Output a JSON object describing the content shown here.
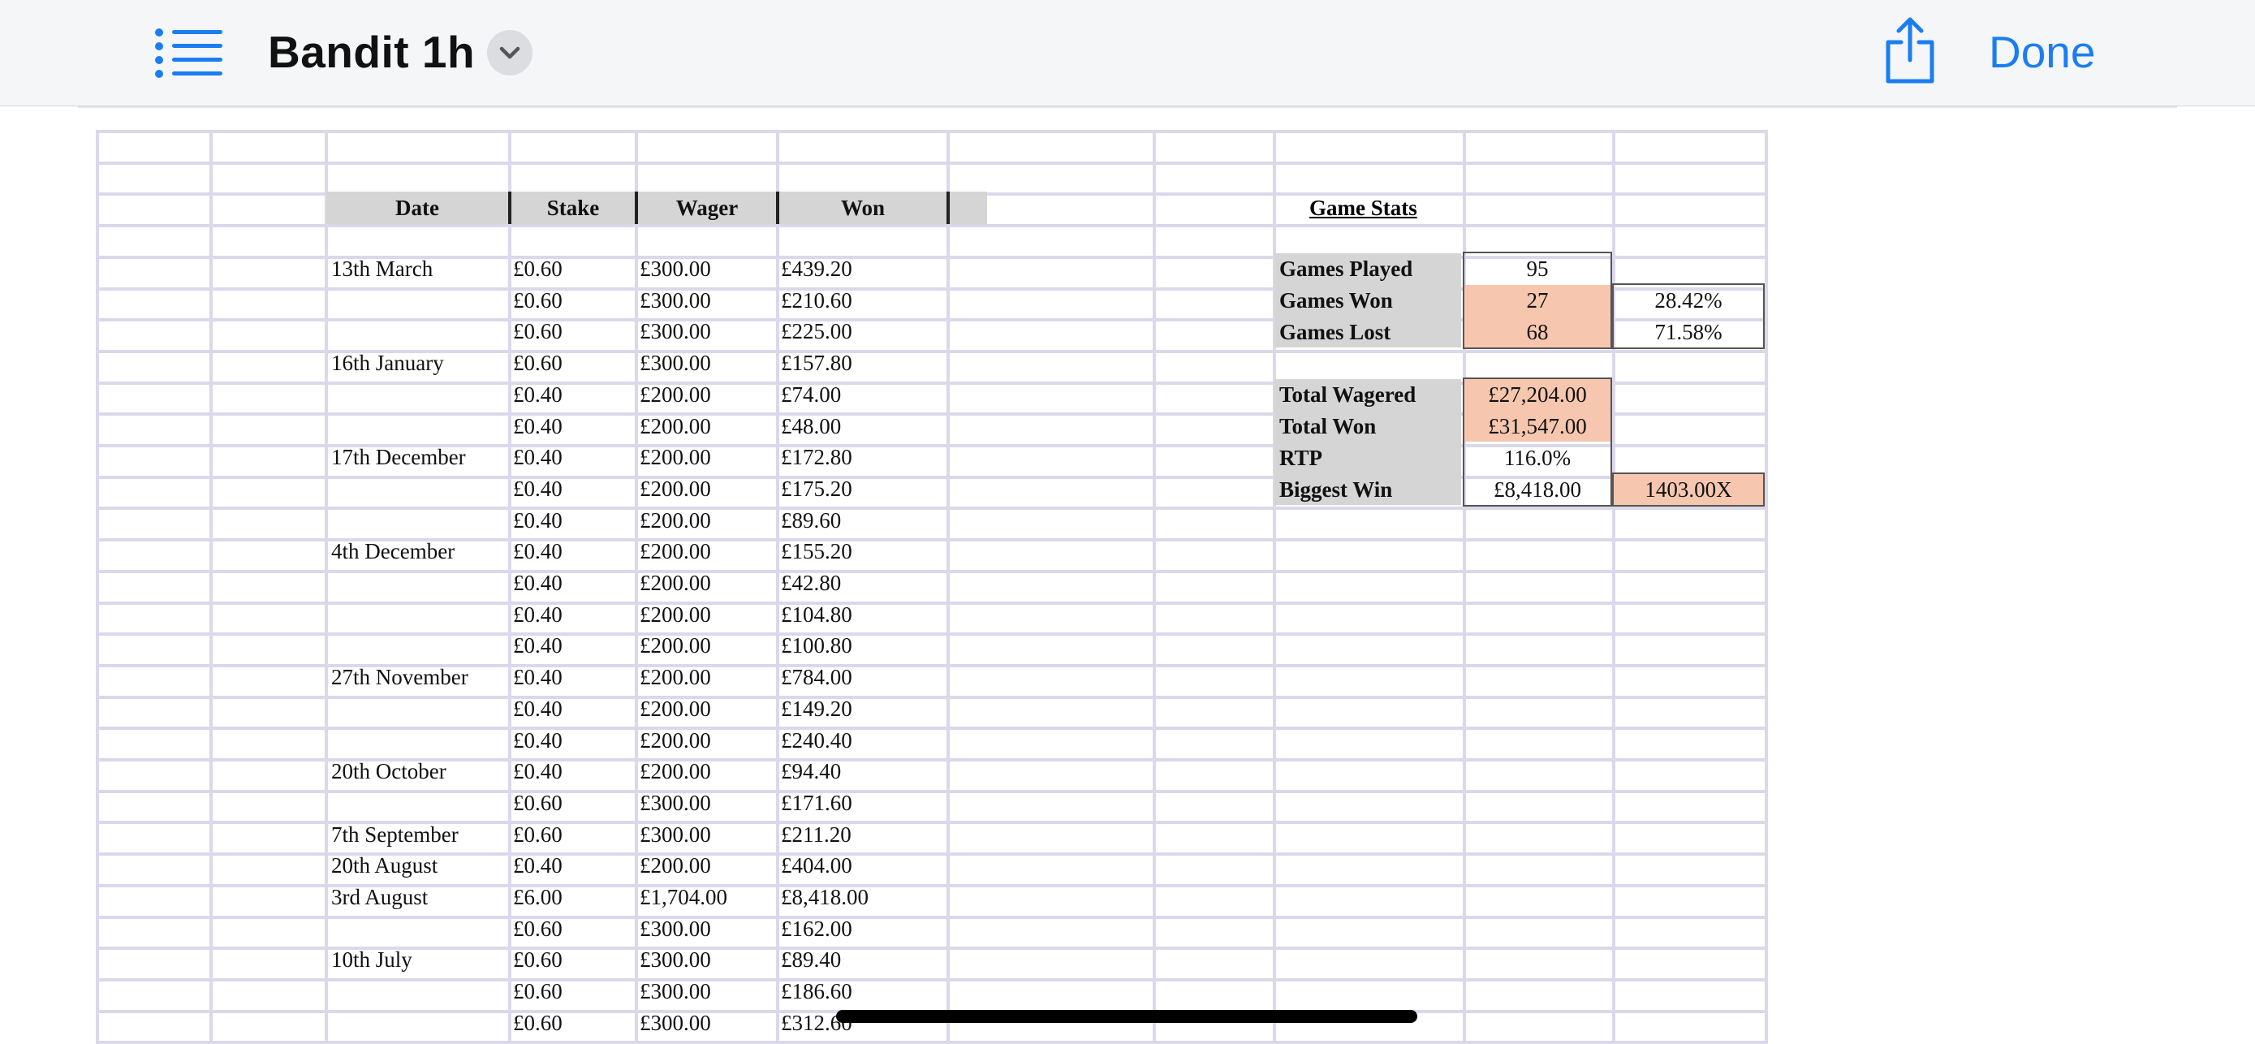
{
  "toolbar": {
    "title": "Bandit 1h",
    "done_label": "Done",
    "list_icon": "list-icon",
    "chevron_icon": "chevron-down-icon",
    "share_icon": "share-icon",
    "accent_color": "#1a7ef2"
  },
  "table": {
    "headers": [
      "Date",
      "Stake",
      "Wager",
      "Won"
    ],
    "rows": [
      [
        "13th March",
        "£0.60",
        "£300.00",
        "£439.20"
      ],
      [
        "",
        "£0.60",
        "£300.00",
        "£210.60"
      ],
      [
        "",
        "£0.60",
        "£300.00",
        "£225.00"
      ],
      [
        "16th January",
        "£0.60",
        "£300.00",
        "£157.80"
      ],
      [
        "",
        "£0.40",
        "£200.00",
        "£74.00"
      ],
      [
        "",
        "£0.40",
        "£200.00",
        "£48.00"
      ],
      [
        "17th December",
        "£0.40",
        "£200.00",
        "£172.80"
      ],
      [
        "",
        "£0.40",
        "£200.00",
        "£175.20"
      ],
      [
        "",
        "£0.40",
        "£200.00",
        "£89.60"
      ],
      [
        "4th December",
        "£0.40",
        "£200.00",
        "£155.20"
      ],
      [
        "",
        "£0.40",
        "£200.00",
        "£42.80"
      ],
      [
        "",
        "£0.40",
        "£200.00",
        "£104.80"
      ],
      [
        "",
        "£0.40",
        "£200.00",
        "£100.80"
      ],
      [
        "27th November",
        "£0.40",
        "£200.00",
        "£784.00"
      ],
      [
        "",
        "£0.40",
        "£200.00",
        "£149.20"
      ],
      [
        "",
        "£0.40",
        "£200.00",
        "£240.40"
      ],
      [
        "20th October",
        "£0.40",
        "£200.00",
        "£94.40"
      ],
      [
        "",
        "£0.60",
        "£300.00",
        "£171.60"
      ],
      [
        "7th September",
        "£0.60",
        "£300.00",
        "£211.20"
      ],
      [
        "20th August",
        "£0.40",
        "£200.00",
        "£404.00"
      ],
      [
        "3rd August",
        "£6.00",
        "£1,704.00",
        "£8,418.00"
      ],
      [
        "",
        "£0.60",
        "£300.00",
        "£162.00"
      ],
      [
        "10th July",
        "£0.60",
        "£300.00",
        "£89.40"
      ],
      [
        "",
        "£0.60",
        "£300.00",
        "£186.60"
      ],
      [
        "",
        "£0.60",
        "£300.00",
        "£312.60"
      ]
    ]
  },
  "stats": {
    "title": "Game Stats",
    "games_played_label": "Games Played",
    "games_played": "95",
    "games_won_label": "Games Won",
    "games_won": "27",
    "games_won_pct": "28.42%",
    "games_lost_label": "Games Lost",
    "games_lost": "68",
    "games_lost_pct": "71.58%",
    "total_wagered_label": "Total Wagered",
    "total_wagered": "£27,204.00",
    "total_won_label": "Total Won",
    "total_won": "£31,547.00",
    "rtp_label": "RTP",
    "rtp": "116.0%",
    "biggest_win_label": "Biggest Win",
    "biggest_win": "£8,418.00",
    "biggest_win_multiplier": "1403.00X",
    "highlight_color": "#f6c7ae",
    "label_bg_color": "#d5d5d5"
  }
}
